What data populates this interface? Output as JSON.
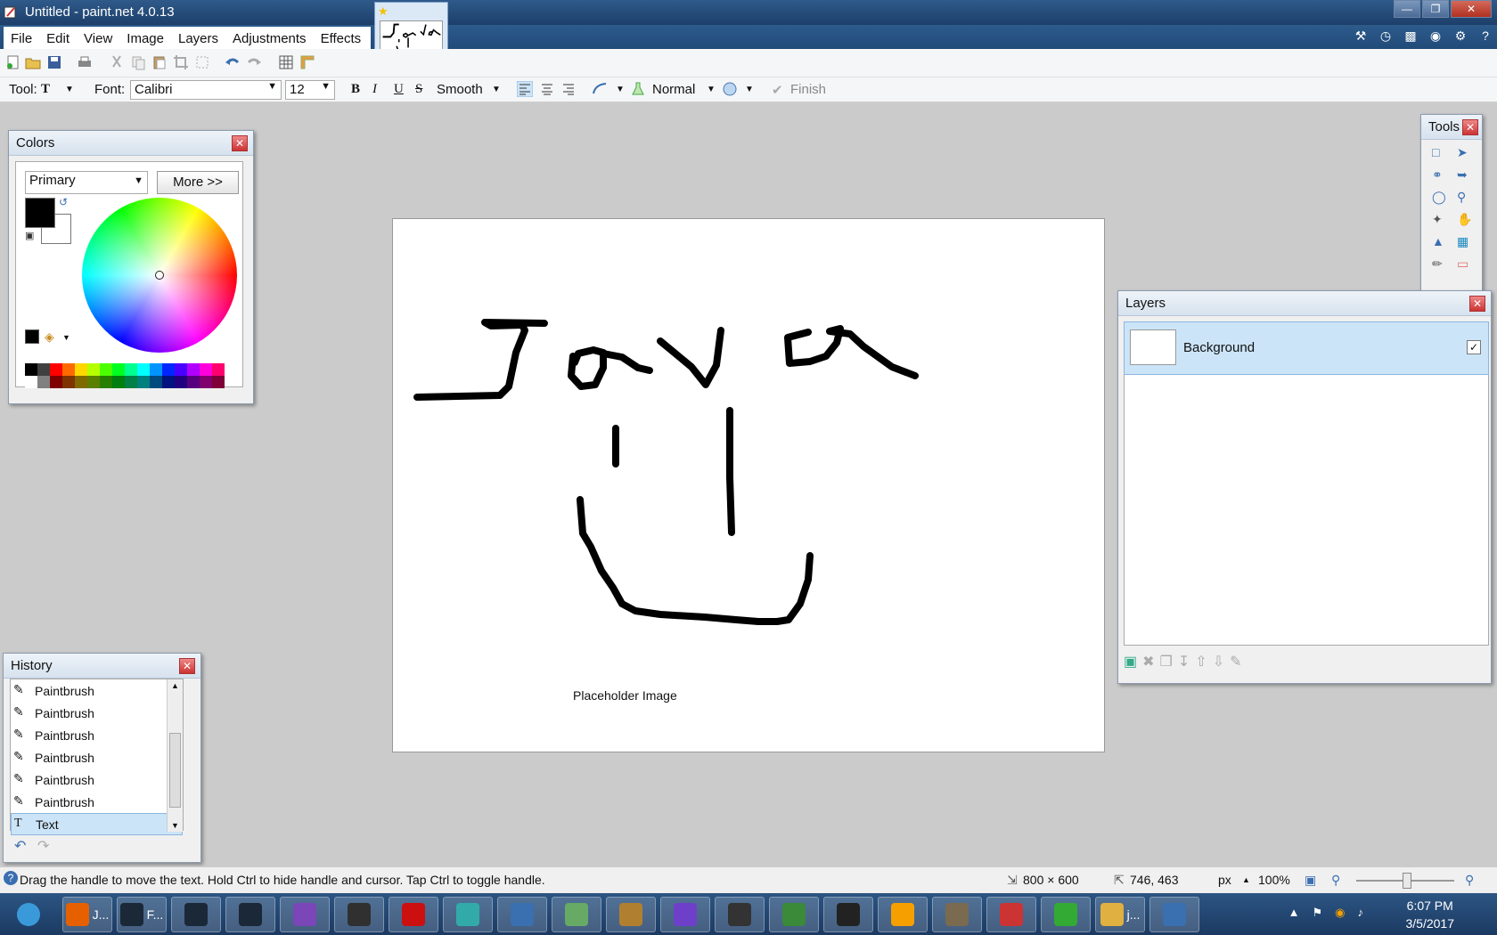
{
  "window": {
    "title": "Untitled - paint.net 4.0.13"
  },
  "menu": [
    "File",
    "Edit",
    "View",
    "Image",
    "Layers",
    "Adjustments",
    "Effects"
  ],
  "toolbar": {
    "tool_label": "Tool:",
    "font_label": "Font:",
    "font_value": "Calibri",
    "size_value": "12",
    "bold": "B",
    "italic": "I",
    "underline": "U",
    "strike": "S",
    "smoothing": "Smooth",
    "blend_mode": "Normal",
    "finish": "Finish"
  },
  "colors_panel": {
    "title": "Colors",
    "mode": "Primary",
    "more_button": "More >>",
    "primary_color": "#000000",
    "secondary_color": "#ffffff",
    "palette_top": [
      "#000000",
      "#404040",
      "#ff0000",
      "#ff6a00",
      "#ffd800",
      "#b6ff00",
      "#4cff00",
      "#00ff21",
      "#00ff90",
      "#00ffff",
      "#0094ff",
      "#0026ff",
      "#4800ff",
      "#b200ff",
      "#ff00dc",
      "#ff006e"
    ],
    "palette_bottom": [
      "#ffffff",
      "#808080",
      "#7f0000",
      "#7f3300",
      "#7f6a00",
      "#5b7f00",
      "#267f00",
      "#007f0e",
      "#007f46",
      "#007f7f",
      "#004a7f",
      "#00137f",
      "#21007f",
      "#57007f",
      "#7f006e",
      "#7f0037"
    ]
  },
  "history_panel": {
    "title": "History",
    "items": [
      {
        "label": "Paintbrush",
        "icon": "paintbrush-icon"
      },
      {
        "label": "Paintbrush",
        "icon": "paintbrush-icon"
      },
      {
        "label": "Paintbrush",
        "icon": "paintbrush-icon"
      },
      {
        "label": "Paintbrush",
        "icon": "paintbrush-icon"
      },
      {
        "label": "Paintbrush",
        "icon": "paintbrush-icon"
      },
      {
        "label": "Paintbrush",
        "icon": "paintbrush-icon"
      },
      {
        "label": "Text",
        "icon": "text-tool-icon",
        "selected": true
      }
    ]
  },
  "tools_panel": {
    "title": "Tools"
  },
  "layers_panel": {
    "title": "Layers",
    "layers": [
      {
        "name": "Background",
        "visible": true
      }
    ]
  },
  "canvas": {
    "caption": "Placeholder Image",
    "thumb_text": "Jovon"
  },
  "statusbar": {
    "hint": "Drag the handle to move the text. Hold Ctrl to hide handle and cursor. Tap Ctrl to toggle handle.",
    "image_size": "800 × 600",
    "cursor_pos": "746, 463",
    "unit": "px",
    "zoom": "100%"
  },
  "taskbar": {
    "items": [
      {
        "name": "start",
        "label": ""
      },
      {
        "name": "firefox",
        "label": "J..."
      },
      {
        "name": "steam-1",
        "label": "F..."
      },
      {
        "name": "steam-2",
        "label": ""
      },
      {
        "name": "steam-3",
        "label": ""
      },
      {
        "name": "visual-studio",
        "label": ""
      },
      {
        "name": "obs",
        "label": ""
      },
      {
        "name": "flash",
        "label": ""
      },
      {
        "name": "window-app",
        "label": ""
      },
      {
        "name": "network-app",
        "label": ""
      },
      {
        "name": "notepad",
        "label": ""
      },
      {
        "name": "dosbox",
        "label": ""
      },
      {
        "name": "github",
        "label": ""
      },
      {
        "name": "ring-app",
        "label": ""
      },
      {
        "name": "vim",
        "label": ""
      },
      {
        "name": "terminal",
        "label": ""
      },
      {
        "name": "audacity",
        "label": ""
      },
      {
        "name": "gimp",
        "label": ""
      },
      {
        "name": "git-app",
        "label": ""
      },
      {
        "name": "xbox-app",
        "label": ""
      },
      {
        "name": "explorer",
        "label": "j..."
      },
      {
        "name": "paintnet",
        "label": ""
      }
    ],
    "time": "6:07 PM",
    "date": "3/5/2017"
  }
}
